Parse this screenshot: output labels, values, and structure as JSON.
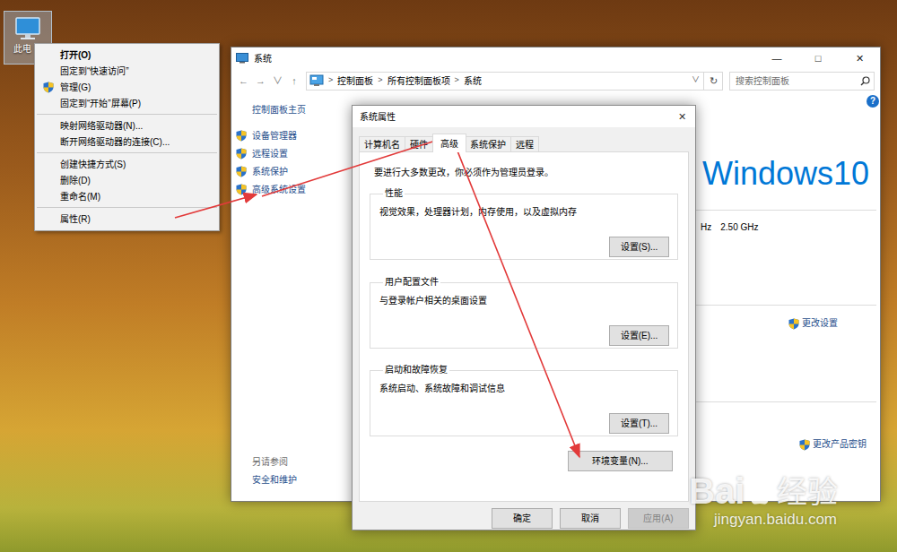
{
  "desktop": {
    "icon": {
      "label": "此电"
    }
  },
  "context_menu": {
    "items": [
      {
        "kind": "item",
        "label": "打开(O)",
        "default": true,
        "shield": false
      },
      {
        "kind": "item",
        "label": "固定到“快速访问”",
        "default": false,
        "shield": false
      },
      {
        "kind": "item",
        "label": "管理(G)",
        "default": false,
        "shield": true
      },
      {
        "kind": "item",
        "label": "固定到“开始”屏幕(P)",
        "default": false,
        "shield": false
      },
      {
        "kind": "separator"
      },
      {
        "kind": "item",
        "label": "映射网络驱动器(N)...",
        "default": false,
        "shield": false
      },
      {
        "kind": "item",
        "label": "断开网络驱动器的连接(C)...",
        "default": false,
        "shield": false
      },
      {
        "kind": "separator"
      },
      {
        "kind": "item",
        "label": "创建快捷方式(S)",
        "default": false,
        "shield": false
      },
      {
        "kind": "item",
        "label": "删除(D)",
        "default": false,
        "shield": false
      },
      {
        "kind": "item",
        "label": "重命名(M)",
        "default": false,
        "shield": false
      },
      {
        "kind": "separator"
      },
      {
        "kind": "item",
        "label": "属性(R)",
        "default": false,
        "shield": false
      }
    ]
  },
  "system_window": {
    "title": "系统",
    "controls": [
      "—",
      "□",
      "✕"
    ],
    "address_bar": {
      "nav": [
        "←",
        "→",
        "∨",
        "↑"
      ],
      "separator": ">",
      "breadcrumbs": [
        "控制面板",
        "所有控制面板项",
        "系统"
      ],
      "dropdown": "∨",
      "refresh": "↻"
    },
    "search": {
      "placeholder": "搜索控制面板"
    },
    "help": "?",
    "sidebar": {
      "home": "控制面板主页",
      "items": [
        "设备管理器",
        "远程设置",
        "系统保护",
        "高级系统设置"
      ],
      "see_also": {
        "title": "另请参阅",
        "links": [
          "安全和维护"
        ]
      }
    },
    "content": {
      "logo": "Windows10",
      "cpu": [
        "Hz",
        "2.50 GHz"
      ],
      "change_settings": "更改设置",
      "change_key": "更改产品密钥"
    }
  },
  "dialog": {
    "title": "系统属性",
    "close": "✕",
    "tabs": [
      {
        "label": "计算机名",
        "selected": false
      },
      {
        "label": "硬件",
        "selected": false
      },
      {
        "label": "高级",
        "selected": true
      },
      {
        "label": "系统保护",
        "selected": false
      },
      {
        "label": "远程",
        "selected": false
      }
    ],
    "notice": "要进行大多数更改，你必须作为管理员登录。",
    "groups": [
      {
        "title": "性能",
        "description": "视觉效果，处理器计划，内存使用，以及虚拟内存",
        "button": "设置(S)..."
      },
      {
        "title": "用户配置文件",
        "description": "与登录帐户相关的桌面设置",
        "button": "设置(E)..."
      },
      {
        "title": "启动和故障恢复",
        "description": "系统启动、系统故障和调试信息",
        "button": "设置(T)..."
      }
    ],
    "env_button": "环境变量(N)...",
    "buttons": [
      {
        "label": "确定",
        "disabled": false
      },
      {
        "label": "取消",
        "disabled": false
      },
      {
        "label": "应用(A)",
        "disabled": true
      }
    ]
  },
  "watermark": {
    "brand": "Bai",
    "brand_cn": "经验",
    "url": "jingyan.baidu.com"
  }
}
